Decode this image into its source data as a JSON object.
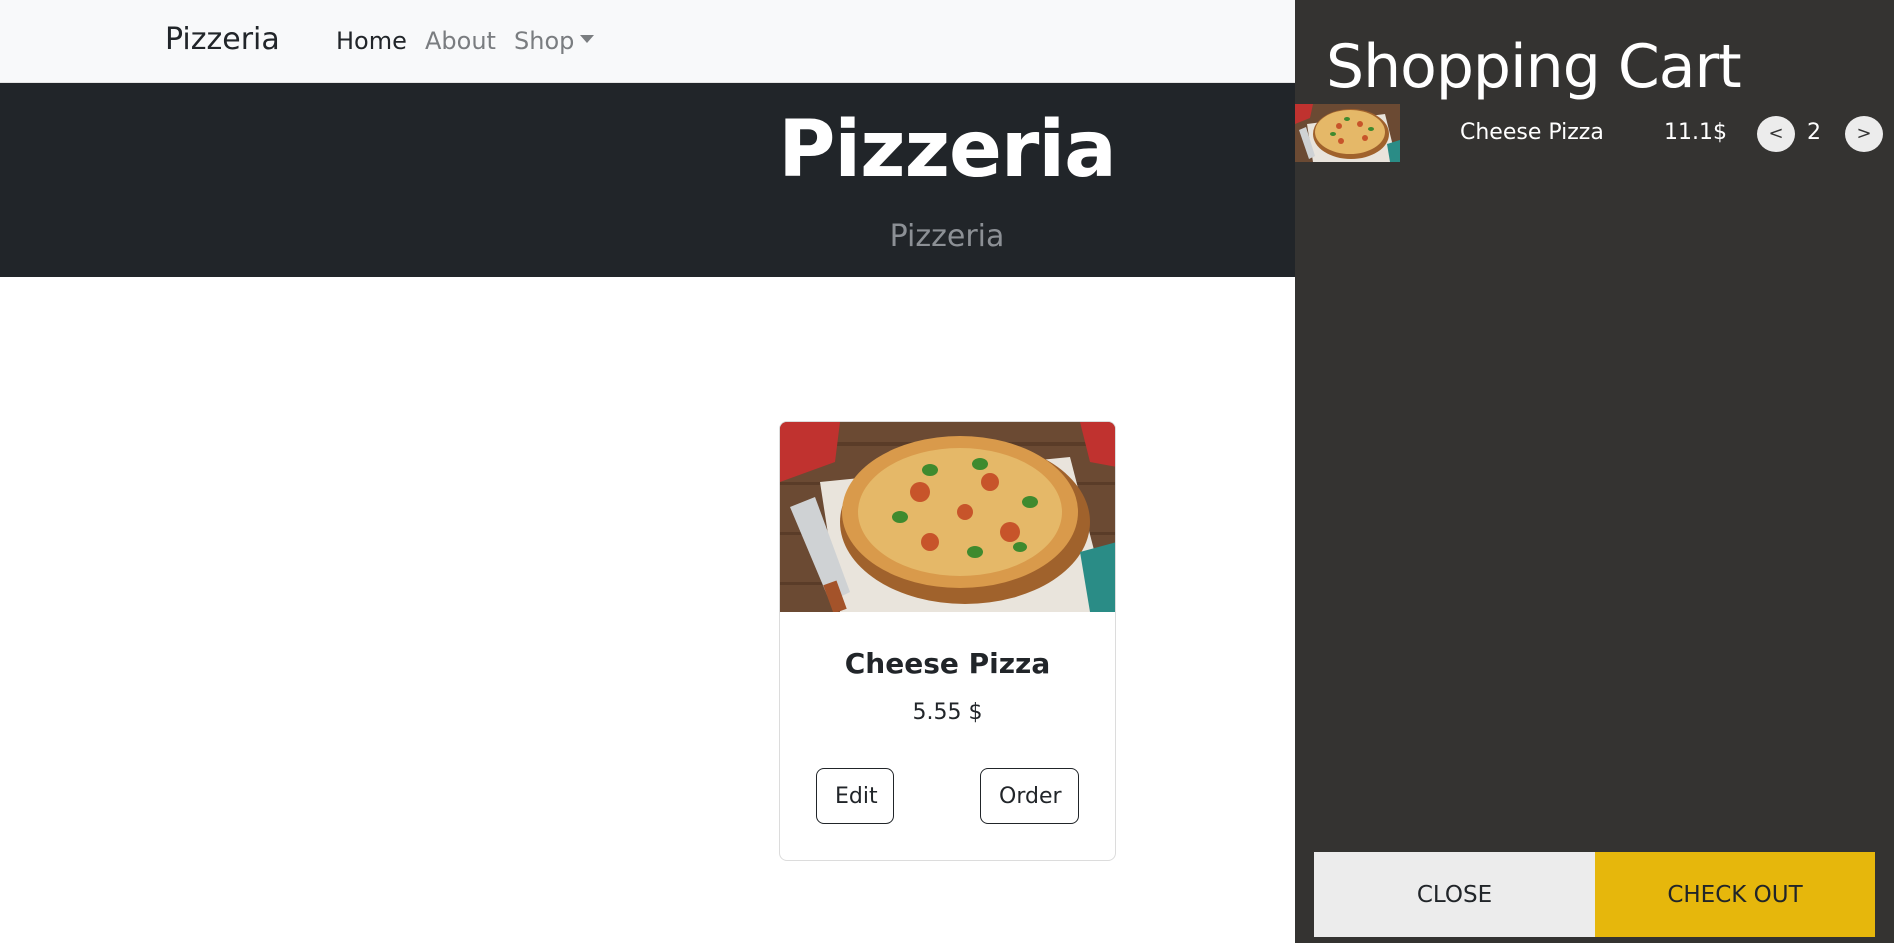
{
  "navbar": {
    "brand": "Pizzeria",
    "links": [
      {
        "label": "Home"
      },
      {
        "label": "About"
      },
      {
        "label": "Shop"
      }
    ]
  },
  "hero": {
    "title": "Pizzeria",
    "subtitle": "Pizzeria"
  },
  "product": {
    "name": "Cheese Pizza",
    "price": "5.55 $",
    "edit_label": "Edit",
    "order_label": "Order"
  },
  "cart": {
    "title": "Shopping Cart",
    "items": [
      {
        "name": "Cheese Pizza",
        "price": "11.1$",
        "quantity": "2",
        "decrement_label": "<",
        "increment_label": ">"
      }
    ],
    "close_label": "CLOSE",
    "checkout_label": "CHECK OUT"
  },
  "colors": {
    "navbar_bg": "#f8f9fa",
    "hero_bg": "#212529",
    "cart_bg": "#343331",
    "checkout_accent": "#e6b70c"
  }
}
